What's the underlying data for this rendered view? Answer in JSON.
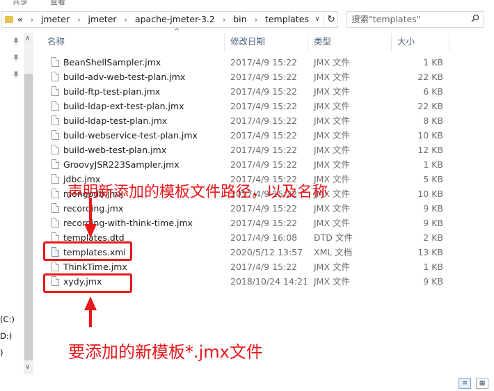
{
  "top_menu": [
    "共享",
    "查看"
  ],
  "address": {
    "back_chevron": "«",
    "crumbs": [
      "jmeter",
      "jmeter",
      "apache-jmeter-3.2",
      "bin",
      "templates"
    ],
    "separator": "›",
    "dropdown_glyph": "∨",
    "refresh_glyph": "↻"
  },
  "search": {
    "placeholder": "搜索\"templates\"",
    "icon": "search-icon"
  },
  "nav": {
    "pins": [
      "pin-icon",
      "pin-icon",
      "pin-icon"
    ],
    "drives": [
      "(C:)",
      "D:)",
      ")"
    ]
  },
  "columns": {
    "name": "名称",
    "date": "修改日期",
    "type": "类型",
    "size": "大小"
  },
  "files": [
    {
      "name": "BeanShellSampler.jmx",
      "date": "2017/4/9 15:22",
      "type": "JMX 文件",
      "size": "1 KB",
      "icon": "file-icon"
    },
    {
      "name": "build-adv-web-test-plan.jmx",
      "date": "2017/4/9 15:22",
      "type": "JMX 文件",
      "size": "22 KB",
      "icon": "file-icon"
    },
    {
      "name": "build-ftp-test-plan.jmx",
      "date": "2017/4/9 15:22",
      "type": "JMX 文件",
      "size": "6 KB",
      "icon": "file-icon"
    },
    {
      "name": "build-ldap-ext-test-plan.jmx",
      "date": "2017/4/9 15:22",
      "type": "JMX 文件",
      "size": "22 KB",
      "icon": "file-icon"
    },
    {
      "name": "build-ldap-test-plan.jmx",
      "date": "2017/4/9 15:22",
      "type": "JMX 文件",
      "size": "8 KB",
      "icon": "file-icon"
    },
    {
      "name": "build-webservice-test-plan.jmx",
      "date": "2017/4/9 15:22",
      "type": "JMX 文件",
      "size": "10 KB",
      "icon": "file-icon"
    },
    {
      "name": "build-web-test-plan.jmx",
      "date": "2017/4/9 15:22",
      "type": "JMX 文件",
      "size": "12 KB",
      "icon": "file-icon"
    },
    {
      "name": "GroovyJSR223Sampler.jmx",
      "date": "2017/4/9 15:22",
      "type": "JMX 文件",
      "size": "1 KB",
      "icon": "file-icon"
    },
    {
      "name": "jdbc.jmx",
      "date": "2017/4/9 15:22",
      "type": "JMX 文件",
      "size": "5 KB",
      "icon": "file-icon"
    },
    {
      "name": "mongodb.jmx",
      "date": "2017/4/9 15:22",
      "type": "JMX 文件",
      "size": "10 KB",
      "icon": "file-icon"
    },
    {
      "name": "recording.jmx",
      "date": "2017/4/9 15:22",
      "type": "JMX 文件",
      "size": "9 KB",
      "icon": "file-icon"
    },
    {
      "name": "recording-with-think-time.jmx",
      "date": "2017/4/9 15:22",
      "type": "JMX 文件",
      "size": "9 KB",
      "icon": "file-icon"
    },
    {
      "name": "templates.dtd",
      "date": "2017/4/9 16:08",
      "type": "DTD 文件",
      "size": "2 KB",
      "icon": "file-icon"
    },
    {
      "name": "templates.xml",
      "date": "2020/5/12 13:57",
      "type": "XML 文档",
      "size": "13 KB",
      "icon": "xml-file-icon"
    },
    {
      "name": "ThinkTime.jmx",
      "date": "2017/4/9 15:22",
      "type": "JMX 文件",
      "size": "1 KB",
      "icon": "file-icon"
    },
    {
      "name": "xydy.jmx",
      "date": "2018/10/24 14:21",
      "type": "JMX 文件",
      "size": "9 KB",
      "icon": "file-icon"
    }
  ],
  "annotations": {
    "declare_text": "声明新添加的模板文件路径，以及名称",
    "add_text": "要添加的新模板*.jmx文件",
    "color": "#e8171a"
  },
  "view_buttons": [
    "details-view-icon",
    "large-icons-view-icon"
  ]
}
